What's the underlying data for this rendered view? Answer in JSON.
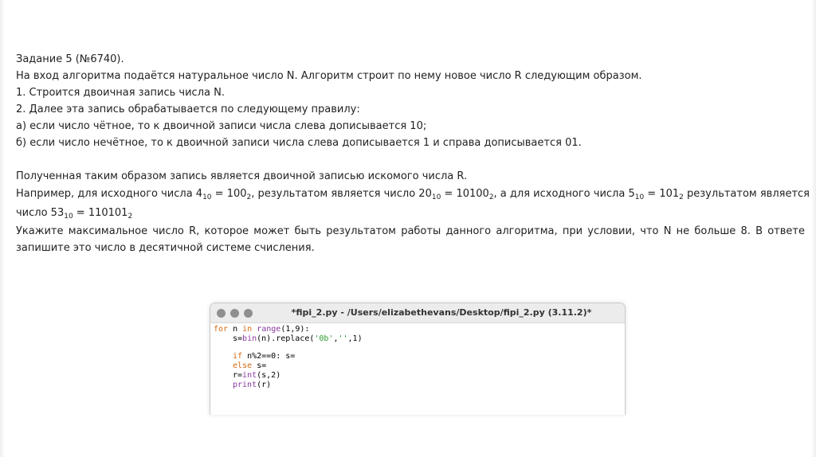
{
  "task": {
    "title": "Задание 5 (№6740).",
    "line1": "На вход алгоритма подаётся натуральное число N. Алгоритм строит по нему новое число R следующим образом.",
    "step1": "1. Строится двоичная запись числа N.",
    "step2": "2. Далее эта запись обрабатывается по следующему правилу:",
    "rule_a": "а) если число чётное, то к двоичной записи числа слева дописывается 10;",
    "rule_b": "б) если число нечётное, то к двоичной записи числа слева дописывается 1 и справа дописывается 01.",
    "result_line": "Полученная таким образом запись является двоичной записью искомого числа R.",
    "example": {
      "p1": "Например, для исходного числа 4",
      "s1": "10",
      "p2": " = 100",
      "s2": "2",
      "p3": ", результатом является число 20",
      "s3": "10",
      "p4": " = 10100",
      "s4": "2",
      "p5": ", а для исходного числа 5",
      "s5": "10",
      "p6": " = 101",
      "s6": "2",
      "p7": " результатом является",
      "p8": "число 53",
      "s8": "10",
      "p9": " = 110101",
      "s9": "2"
    },
    "question_w": [
      "Укажите",
      "максимальное",
      "число",
      "R,",
      "которое",
      "может",
      "быть",
      "результатом",
      "работы",
      "данного",
      "алгоритма,",
      "при",
      "условии,",
      "что",
      "N",
      "не",
      "больше",
      "8.",
      "В",
      "ответе"
    ],
    "question_line2": "запишите это число в десятичной системе счисления."
  },
  "editor": {
    "window_title": "*fipi_2.py - /Users/elizabethevans/Desktop/fipi_2.py (3.11.2)*",
    "code": {
      "l1_for": "for",
      "l1_n": " n ",
      "l1_in": "in",
      "l1_sp": " ",
      "l1_range": "range",
      "l1_args": "(1,9):",
      "l2_a": "s=",
      "l2_bin": "bin",
      "l2_b": "(n).replace(",
      "l2_s1": "'0b'",
      "l2_c": ",",
      "l2_s2": "''",
      "l2_d": ",1)",
      "l3_if": "if",
      "l3_rest": " n%2==0: s=",
      "l4_else": "else",
      "l4_rest": " s=",
      "l5_a": "r=",
      "l5_int": "int",
      "l5_b": "(s,2)",
      "l6_print": "print",
      "l6_b": "(r)"
    }
  },
  "colors": {
    "keyword": "#d36a12",
    "builtin": "#8a3aa0",
    "string": "#2a9a2a",
    "traffic_light": "#8f8f8f"
  }
}
